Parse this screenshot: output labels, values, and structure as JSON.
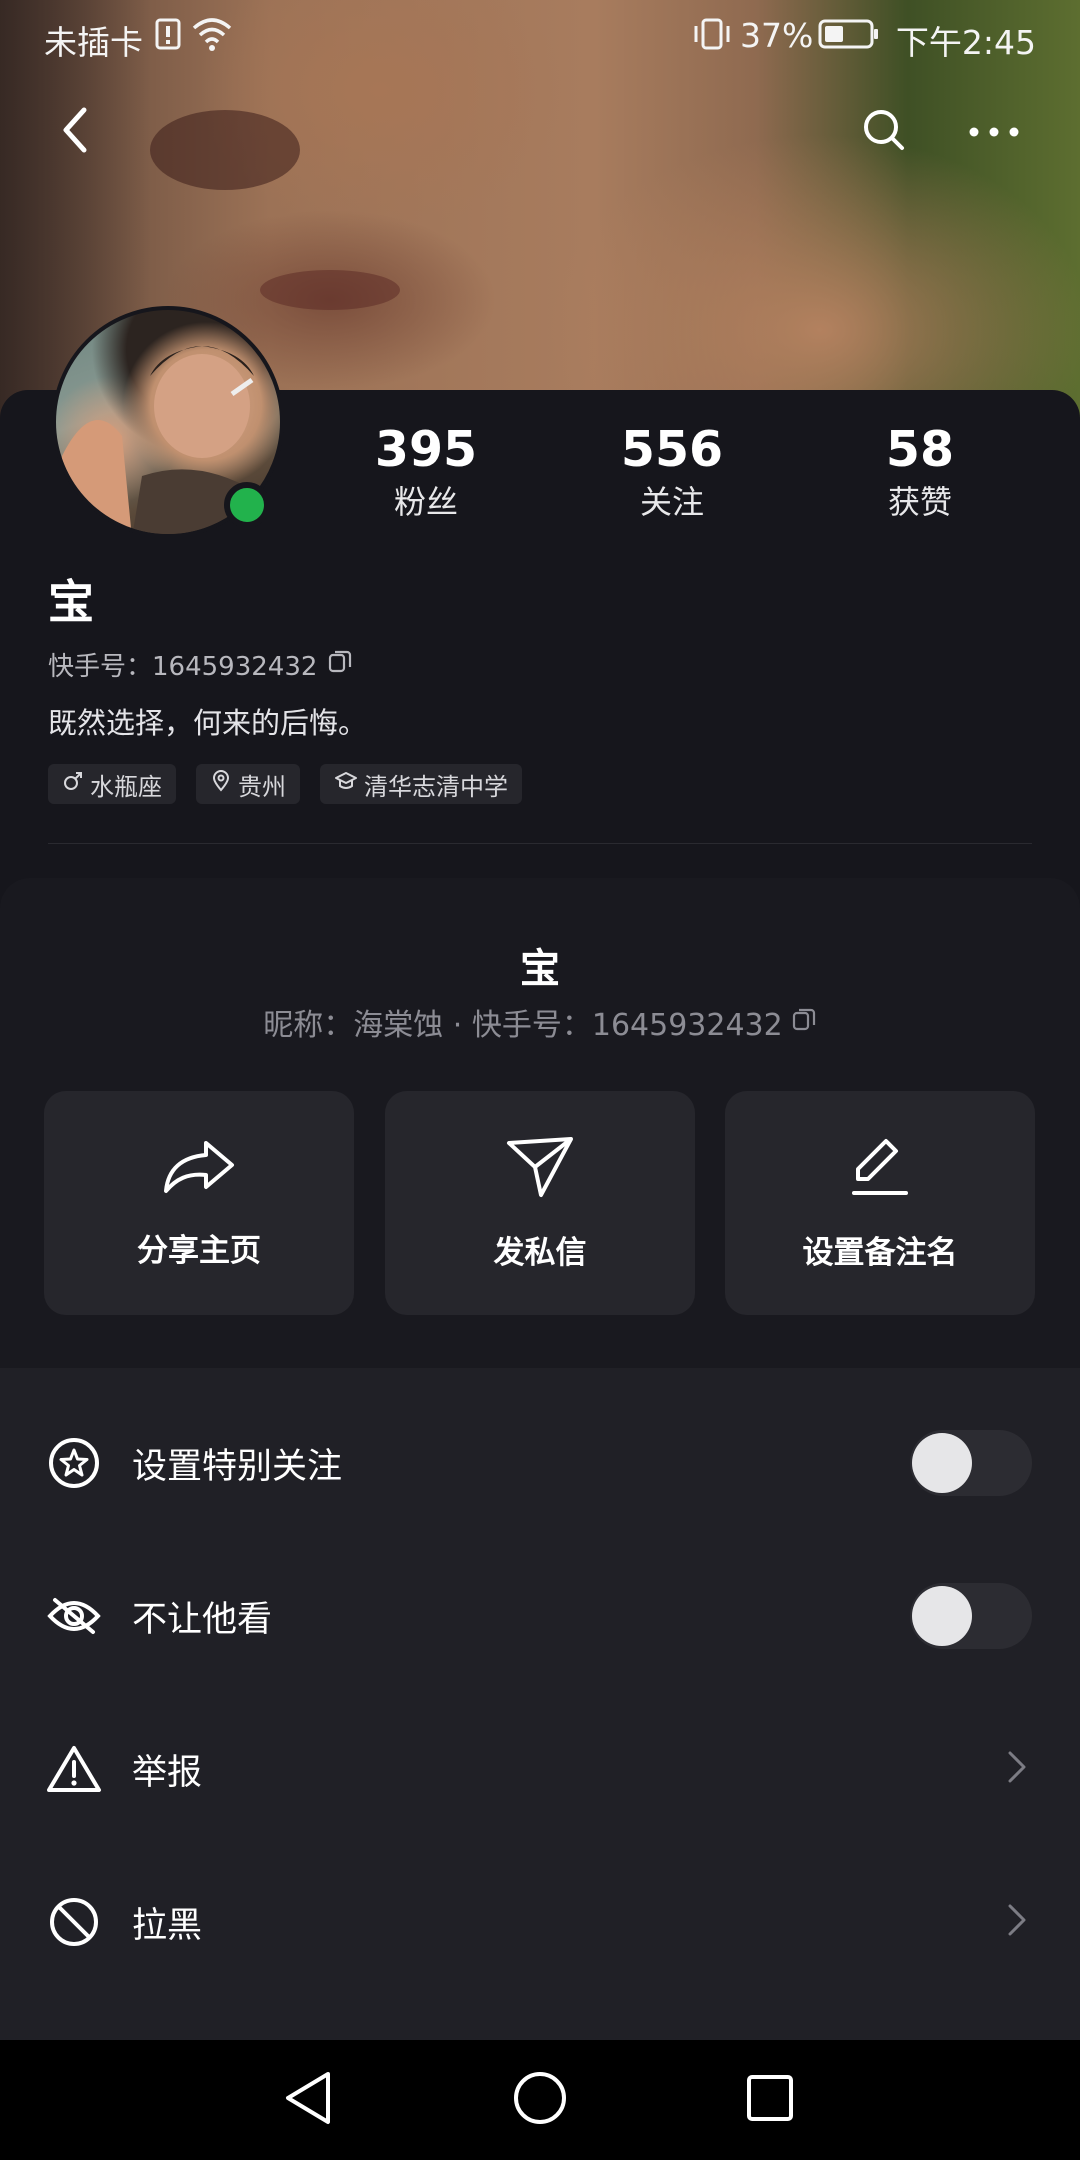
{
  "status_bar": {
    "carrier": "未插卡",
    "battery_percent": "37%",
    "time": "下午2:45"
  },
  "cover": {
    "icons": [
      "back-icon",
      "search-icon",
      "more-icon"
    ]
  },
  "profile": {
    "stats": [
      {
        "value": "395",
        "label": "粉丝"
      },
      {
        "value": "556",
        "label": "关注"
      },
      {
        "value": "58",
        "label": "获赞"
      }
    ],
    "name": "宝",
    "kuaishou_id": "快手号：1645932432",
    "bio": "既然选择，何来的后悔。",
    "tags": [
      {
        "icon": "male-icon",
        "label": "水瓶座"
      },
      {
        "icon": "location-icon",
        "label": "贵州"
      },
      {
        "icon": "school-icon",
        "label": "清华志清中学"
      }
    ],
    "online_color": "#22b24c"
  },
  "sheet": {
    "name": "宝",
    "subline": "昵称：海棠蚀 · 快手号：1645932432",
    "actions": [
      {
        "icon": "share-icon",
        "label": "分享主页"
      },
      {
        "icon": "send-icon",
        "label": "发私信"
      },
      {
        "icon": "edit-icon",
        "label": "设置备注名"
      }
    ],
    "rows": [
      {
        "icon": "star-icon",
        "label": "设置特别关注",
        "control": "toggle",
        "on": false
      },
      {
        "icon": "eye-off-icon",
        "label": "不让他看",
        "control": "toggle",
        "on": false
      },
      {
        "icon": "warning-icon",
        "label": "举报",
        "control": "chevron"
      },
      {
        "icon": "block-icon",
        "label": "拉黑",
        "control": "chevron"
      }
    ]
  },
  "nav_bar": {
    "icons": [
      "nav-back-icon",
      "nav-home-icon",
      "nav-recent-icon"
    ]
  }
}
